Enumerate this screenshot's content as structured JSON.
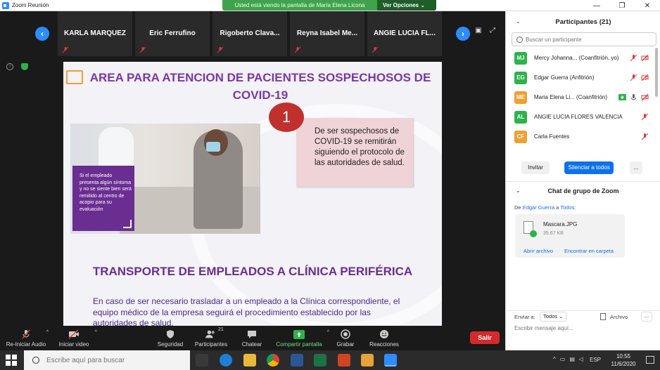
{
  "window": {
    "title": "Zoom Reunión"
  },
  "viewing_banner": {
    "text": "Usted está viendo la pantalla de María Elena Licona",
    "options": "Ver Opciones"
  },
  "strip": {
    "tiles": [
      {
        "name": "KARLA MARQUEZ"
      },
      {
        "name": "Eric Ferrufino"
      },
      {
        "name": "Rigoberto  Clava..."
      },
      {
        "name": "Reyna  Isabel Me..."
      },
      {
        "name": "ANGIE LUCIA FL..."
      }
    ]
  },
  "slide": {
    "title": "AREA PARA ATENCION DE PACIENTES SOSPECHOSOS DE COVID-19",
    "badge": "1",
    "box_text": "De ser sospechosos de COVID-19 se remitirán siguiendo el protocolo de las autoridades de salud.",
    "photo_caption": "Si el empleado presenta algún síntoma y no se siente bien será remitido al centro de acopio para su evaluación",
    "title2": "TRANSPORTE DE EMPLEADOS A CLÍNICA PERIFÉRICA",
    "body2": "En caso de ser necesario trasladar a un empleado a la Clínica correspondiente, el equipo médico de la empresa seguirá el procedimiento establecido por las autoridades de salud."
  },
  "toolbar": {
    "audio": "Re-Iniciar Audio",
    "video": "Iniciar video",
    "security": "Seguridad",
    "participants": "Participantes",
    "participants_count": "21",
    "chat": "Chatear",
    "share": "Compartir pantalla",
    "record": "Grabar",
    "reactions": "Reacciones",
    "leave": "Salir"
  },
  "participants": {
    "title": "Participantes (21)",
    "search_placeholder": "Buscar un participante",
    "list": [
      {
        "initials": "MJ",
        "name": "Mercy Johanna... (Coanfitrión, yo)",
        "color": "#2cb34a"
      },
      {
        "initials": "EG",
        "name": "Edgar Guerra (Anfitrión)",
        "color": "#2cb34a"
      },
      {
        "initials": "ME",
        "name": "Maria Elena Li...  (Coanfitrión)",
        "color": "#f0a030"
      },
      {
        "initials": "AL",
        "name": "ANGIE LUCIA FLORES VALENCIA",
        "color": "#2cb34a"
      },
      {
        "initials": "CF",
        "name": "Carla Fuentes",
        "color": "#f0a030"
      }
    ],
    "invite": "Invitar",
    "mute_all": "Silenciar a todos",
    "more": "..."
  },
  "chat": {
    "title": "Chat de grupo de Zoom",
    "from_prefix": "De",
    "from_name": "Edgar Guerra",
    "to_word": "a",
    "to_name": "Todos:",
    "file_name": "Mascara.JPG",
    "file_size": "35.67 KB",
    "open_file": "Abrir archivo",
    "find_folder": "Encontrar en carpeta",
    "send_to_label": "Enviar a:",
    "send_to_value": "Todos",
    "file_button": "Archivo",
    "more": "...",
    "message_placeholder": "Escribir mensaje aquí..."
  },
  "taskbar": {
    "search_placeholder": "Escribe aquí para buscar",
    "lang": "ESP",
    "time": "10:55",
    "date": "11/6/2020"
  },
  "colors": {
    "accent": "#2d8cff",
    "slide_purple": "#6a2d91",
    "leave_red": "#d52a2a"
  }
}
